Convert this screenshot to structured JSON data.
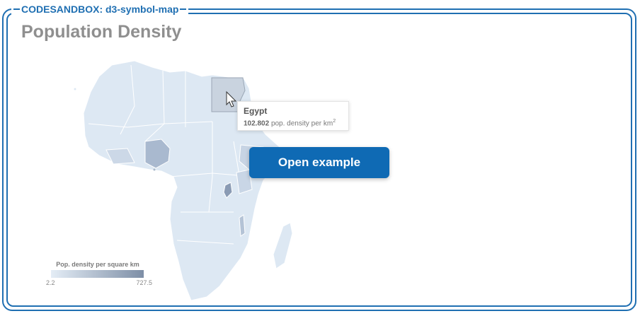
{
  "sandbox": {
    "label": "CODESANDBOX: d3-symbol-map"
  },
  "page": {
    "title": "Population Density"
  },
  "tooltip": {
    "country": "Egypt",
    "value": "102.802",
    "unit_text": "pop. density per km",
    "unit_exp": "2"
  },
  "button": {
    "label": "Open example"
  },
  "legend": {
    "title": "Pop. density per square km",
    "min": "2.2",
    "max": "727.5",
    "color_low": "#e4edf6",
    "color_high": "#7d8ea6"
  },
  "colors": {
    "accent": "#1f6fb2",
    "button": "#0f6ab4",
    "map_base": "#dde8f3"
  },
  "map": {
    "highlighted_region": "Egypt",
    "cursor": "arrow-cursor-icon"
  }
}
